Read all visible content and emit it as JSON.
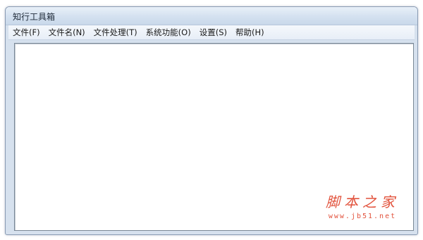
{
  "window": {
    "title": "知行工具箱"
  },
  "menu": {
    "items": [
      {
        "label": "文件(F)"
      },
      {
        "label": "文件名(N)"
      },
      {
        "label": "文件处理(T)"
      },
      {
        "label": "系统功能(O)"
      },
      {
        "label": "设置(S)"
      },
      {
        "label": "帮助(H)"
      }
    ]
  },
  "watermark": {
    "brand": "脚本之家",
    "url": "www.jb51.net"
  },
  "colors": {
    "watermark": "#e2533d",
    "titlebar": "#d4e1f0",
    "client_bg": "#ffffff"
  }
}
